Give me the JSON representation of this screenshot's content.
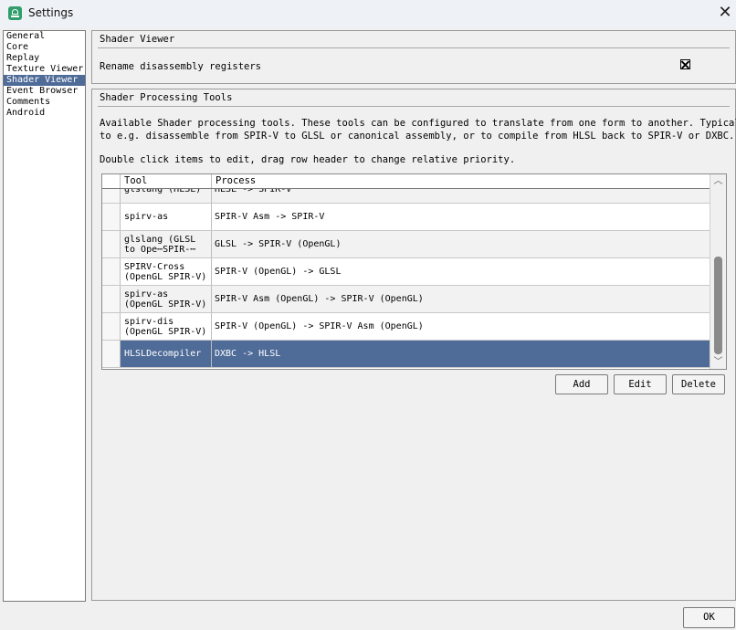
{
  "window": {
    "title": "Settings"
  },
  "nav": {
    "items": [
      {
        "label": "General"
      },
      {
        "label": "Core"
      },
      {
        "label": "Replay"
      },
      {
        "label": "Texture Viewer"
      },
      {
        "label": "Shader Viewer",
        "selected": true
      },
      {
        "label": "Event Browser"
      },
      {
        "label": "Comments"
      },
      {
        "label": "Android"
      }
    ]
  },
  "shader_viewer": {
    "title": "Shader Viewer",
    "rename_label": "Rename disassembly registers",
    "rename_checked": true
  },
  "tools": {
    "title": "Shader Processing Tools",
    "desc_line1": "Available Shader processing tools. These tools can be configured to translate from one form to another. Typically",
    "desc_line2": "to e.g. disassemble from SPIR-V to GLSL or canonical assembly, or to compile from HLSL back to SPIR-V or DXBC.",
    "hint": "Double click items to edit, drag row header to change relative priority.",
    "columns": {
      "tool": "Tool",
      "process": "Process"
    },
    "rows": [
      {
        "tool": [
          "glslang (HLSL)"
        ],
        "process": "HLSL -> SPIR-V"
      },
      {
        "tool": [
          "spirv-as"
        ],
        "process": "SPIR-V Asm -> SPIR-V"
      },
      {
        "tool": [
          "glslang (GLSL",
          "to Ope⋯SPIR-⋯"
        ],
        "process": "GLSL -> SPIR-V (OpenGL)"
      },
      {
        "tool": [
          "SPIRV-Cross",
          "(OpenGL SPIR-V)"
        ],
        "process": "SPIR-V (OpenGL) -> GLSL"
      },
      {
        "tool": [
          "spirv-as",
          "(OpenGL SPIR-V)"
        ],
        "process": "SPIR-V Asm (OpenGL) -> SPIR-V (OpenGL)"
      },
      {
        "tool": [
          "spirv-dis",
          "(OpenGL SPIR-V)"
        ],
        "process": "SPIR-V (OpenGL) -> SPIR-V Asm (OpenGL)"
      },
      {
        "tool": [
          "HLSLDecompiler"
        ],
        "process": "DXBC -> HLSL",
        "selected": true
      }
    ],
    "buttons": {
      "add": "Add",
      "edit": "Edit",
      "delete": "Delete"
    }
  },
  "footer": {
    "ok": "OK"
  },
  "colors": {
    "selection": "#4f6b98",
    "accent": "#2f9e6b"
  }
}
